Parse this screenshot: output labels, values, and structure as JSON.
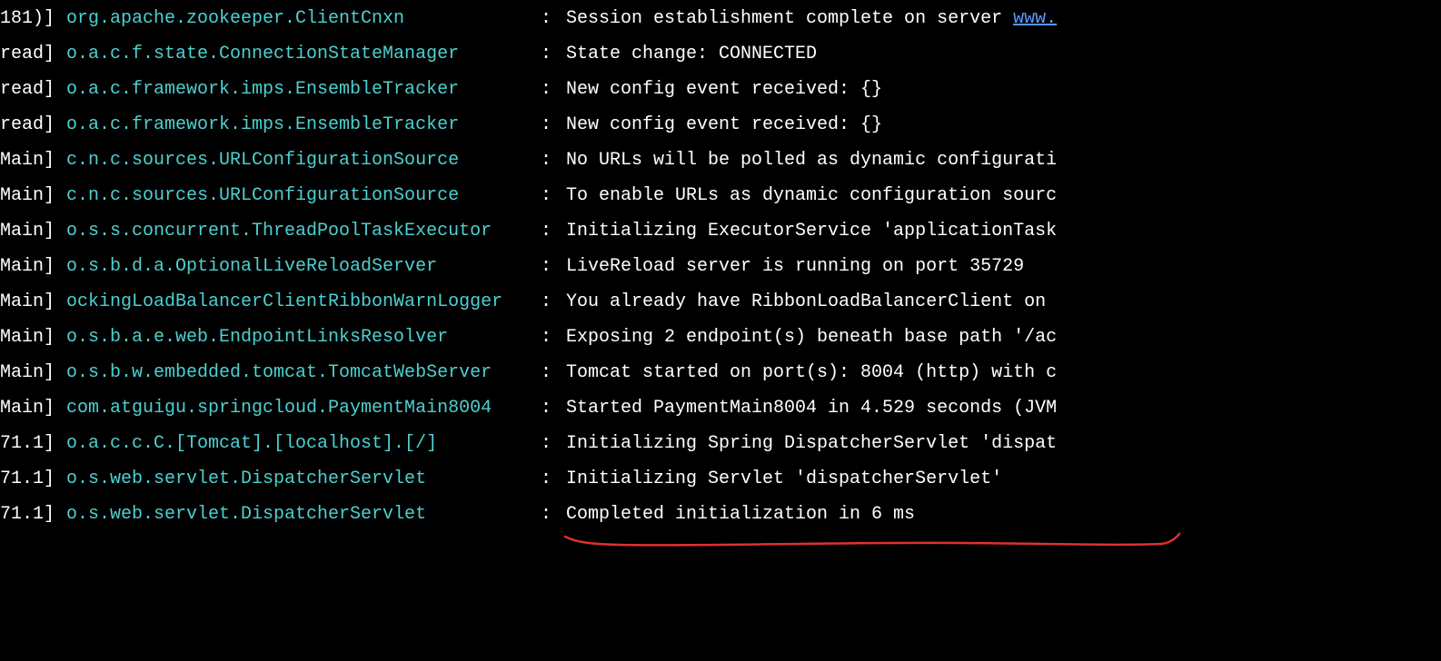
{
  "log": {
    "separator": ": ",
    "link_text": "www.",
    "lines": [
      {
        "thread": "181)]",
        "logger": "org.apache.zookeeper.ClientCnxn",
        "message_prefix": "Session establishment complete on server ",
        "has_link": true
      },
      {
        "thread": "read]",
        "logger": "o.a.c.f.state.ConnectionStateManager",
        "message": "State change: CONNECTED"
      },
      {
        "thread": "read]",
        "logger": "o.a.c.framework.imps.EnsembleTracker",
        "message": "New config event received: {}"
      },
      {
        "thread": "read]",
        "logger": "o.a.c.framework.imps.EnsembleTracker",
        "message": "New config event received: {}"
      },
      {
        "thread": "Main]",
        "logger": "c.n.c.sources.URLConfigurationSource",
        "message": "No URLs will be polled as dynamic configurati"
      },
      {
        "thread": "Main]",
        "logger": "c.n.c.sources.URLConfigurationSource",
        "message": "To enable URLs as dynamic configuration sourc"
      },
      {
        "thread": "Main]",
        "logger": "o.s.s.concurrent.ThreadPoolTaskExecutor",
        "message": "Initializing ExecutorService 'applicationTask"
      },
      {
        "thread": "Main]",
        "logger": "o.s.b.d.a.OptionalLiveReloadServer",
        "message": "LiveReload server is running on port 35729"
      },
      {
        "thread": "Main]",
        "logger": "ockingLoadBalancerClientRibbonWarnLogger",
        "message": "You already have RibbonLoadBalancerClient on "
      },
      {
        "thread": "Main]",
        "logger": "o.s.b.a.e.web.EndpointLinksResolver",
        "message": "Exposing 2 endpoint(s) beneath base path '/ac"
      },
      {
        "thread": "Main]",
        "logger": "o.s.b.w.embedded.tomcat.TomcatWebServer",
        "message": "Tomcat started on port(s): 8004 (http) with c"
      },
      {
        "thread": "Main]",
        "logger": "com.atguigu.springcloud.PaymentMain8004",
        "message": "Started PaymentMain8004 in 4.529 seconds (JVM"
      },
      {
        "thread": "71.1]",
        "logger": "o.a.c.c.C.[Tomcat].[localhost].[/]",
        "message": "Initializing Spring DispatcherServlet 'dispat"
      },
      {
        "thread": "71.1]",
        "logger": "o.s.web.servlet.DispatcherServlet",
        "message": "Initializing Servlet 'dispatcherServlet'"
      },
      {
        "thread": "71.1]",
        "logger": "o.s.web.servlet.DispatcherServlet",
        "message": "Completed initialization in 6 ms"
      }
    ]
  },
  "annotation": {
    "color": "#e03030",
    "stroke_width": 2.5
  }
}
